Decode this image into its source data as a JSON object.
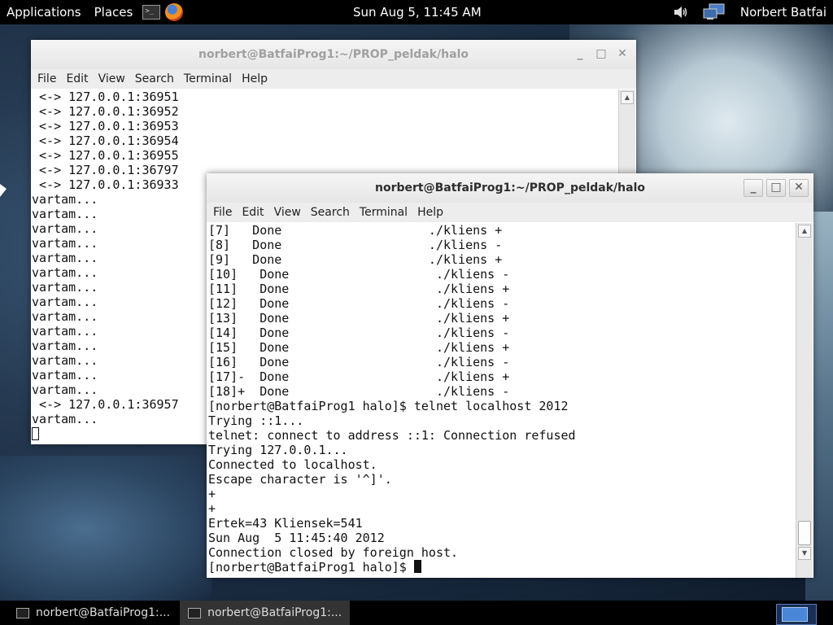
{
  "top_panel": {
    "applications": "Applications",
    "places": "Places",
    "clock": "Sun Aug  5, 11:45 AM",
    "user": "Norbert Batfai",
    "icons": [
      "terminal-launcher-icon",
      "firefox-icon",
      "volume-icon",
      "network-icon"
    ]
  },
  "back_window": {
    "title": "norbert@BatfaiProg1:~/PROP_peldak/halo",
    "menu": [
      "File",
      "Edit",
      "View",
      "Search",
      "Terminal",
      "Help"
    ],
    "lines": [
      " <-> 127.0.0.1:36951",
      " <-> 127.0.0.1:36952",
      " <-> 127.0.0.1:36953",
      " <-> 127.0.0.1:36954",
      " <-> 127.0.0.1:36955",
      " <-> 127.0.0.1:36797",
      " <-> 127.0.0.1:36933",
      "vartam...",
      "vartam...",
      "vartam...",
      "vartam...",
      "vartam...",
      "vartam...",
      "vartam...",
      "vartam...",
      "vartam...",
      "vartam...",
      "vartam...",
      "vartam...",
      "vartam...",
      "vartam...",
      " <-> 127.0.0.1:36957",
      "vartam..."
    ]
  },
  "front_window": {
    "title": "norbert@BatfaiProg1:~/PROP_peldak/halo",
    "menu": [
      "File",
      "Edit",
      "View",
      "Search",
      "Terminal",
      "Help"
    ],
    "lines": [
      "[7]   Done                    ./kliens +",
      "[8]   Done                    ./kliens -",
      "[9]   Done                    ./kliens +",
      "[10]   Done                    ./kliens -",
      "[11]   Done                    ./kliens +",
      "[12]   Done                    ./kliens -",
      "[13]   Done                    ./kliens +",
      "[14]   Done                    ./kliens -",
      "[15]   Done                    ./kliens +",
      "[16]   Done                    ./kliens -",
      "[17]-  Done                    ./kliens +",
      "[18]+  Done                    ./kliens -",
      "[norbert@BatfaiProg1 halo]$ telnet localhost 2012",
      "Trying ::1...",
      "telnet: connect to address ::1: Connection refused",
      "Trying 127.0.0.1...",
      "Connected to localhost.",
      "Escape character is '^]'.",
      "+",
      "+",
      "Ertek=43 Kliensek=541",
      "Sun Aug  5 11:45:40 2012",
      "Connection closed by foreign host.",
      "[norbert@BatfaiProg1 halo]$ "
    ]
  },
  "taskbar": {
    "tasks": [
      "norbert@BatfaiProg1:...",
      "norbert@BatfaiProg1:..."
    ]
  }
}
